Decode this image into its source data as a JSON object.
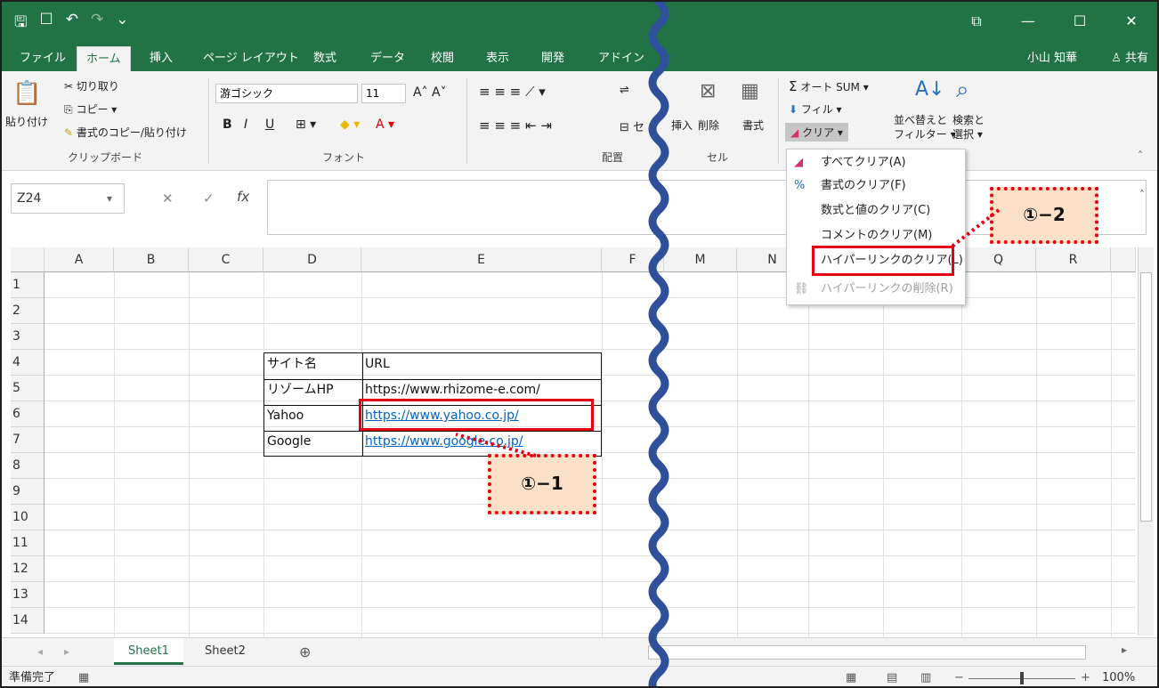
{
  "qat": {
    "save": "🖫",
    "touch": "☐",
    "undo": "↶",
    "redo": "↷",
    "more": "⌄"
  },
  "window": {
    "restore": "⧉",
    "minimize": "—",
    "maximize": "☐",
    "close": "✕"
  },
  "tabs": [
    {
      "label": "ファイル"
    },
    {
      "label": "ホーム"
    },
    {
      "label": "挿入"
    },
    {
      "label": "ページ レイアウト"
    },
    {
      "label": "数式"
    },
    {
      "label": "データ"
    },
    {
      "label": "校閲"
    },
    {
      "label": "表示"
    },
    {
      "label": "開発"
    },
    {
      "label": "アドイン"
    }
  ],
  "user": {
    "name": "小山 知華",
    "share": "共有"
  },
  "ribbon": {
    "paste": "貼り付け",
    "cut": "切り取り",
    "copy": "コピー ▾",
    "format_painter": "書式のコピー/貼り付け",
    "clipboard": "クリップボード",
    "font_name": "游ゴシック",
    "font_size": "11",
    "bold": "B",
    "italic": "I",
    "underline": "U",
    "font_group": "フォント",
    "align_group": "配置",
    "cells_group": "セル",
    "insert": "挿入",
    "delete": "削除",
    "format": "書式",
    "autosum": "オート SUM ▾",
    "fill": "フィル ▾",
    "clear": "クリア ▾",
    "sort": "並べ替えと",
    "sort2": "フィルター ▾",
    "find": "検索と",
    "find2": "選択 ▾",
    "se": "セ"
  },
  "formula": {
    "namebox": "Z24",
    "fx": "fx"
  },
  "columns": [
    "A",
    "B",
    "C",
    "D",
    "E",
    "F",
    "M",
    "N",
    "Q",
    "R"
  ],
  "rows": [
    "1",
    "2",
    "3",
    "4",
    "5",
    "6",
    "7",
    "8",
    "9",
    "10",
    "11",
    "12",
    "13",
    "14"
  ],
  "table": {
    "h1": "サイト名",
    "h2": "URL",
    "r1c1": "リゾームHP",
    "r1c2": "https://www.rhizome-e.com/",
    "r2c1": "Yahoo",
    "r2c2": "https://www.yahoo.co.jp/",
    "r3c1": "Google",
    "r3c2": "https://www.google.co.jp/"
  },
  "dropdown": [
    {
      "label": "すべてクリア(A)"
    },
    {
      "label": "書式のクリア(F)"
    },
    {
      "label": "数式と値のクリア(C)"
    },
    {
      "label": "コメントのクリア(M)"
    },
    {
      "label": "ハイパーリンクのクリア(L)"
    },
    {
      "label": "ハイパーリンクの削除(R)"
    }
  ],
  "callouts": {
    "c1": "①−1",
    "c2": "①−2"
  },
  "sheets": [
    "Sheet1",
    "Sheet2"
  ],
  "status": {
    "ready": "準備完了",
    "zoom": "100%"
  },
  "colors": {
    "excel_green": "#217346",
    "annotation_red": "#e60012",
    "wave_blue": "#2e4f9a"
  }
}
